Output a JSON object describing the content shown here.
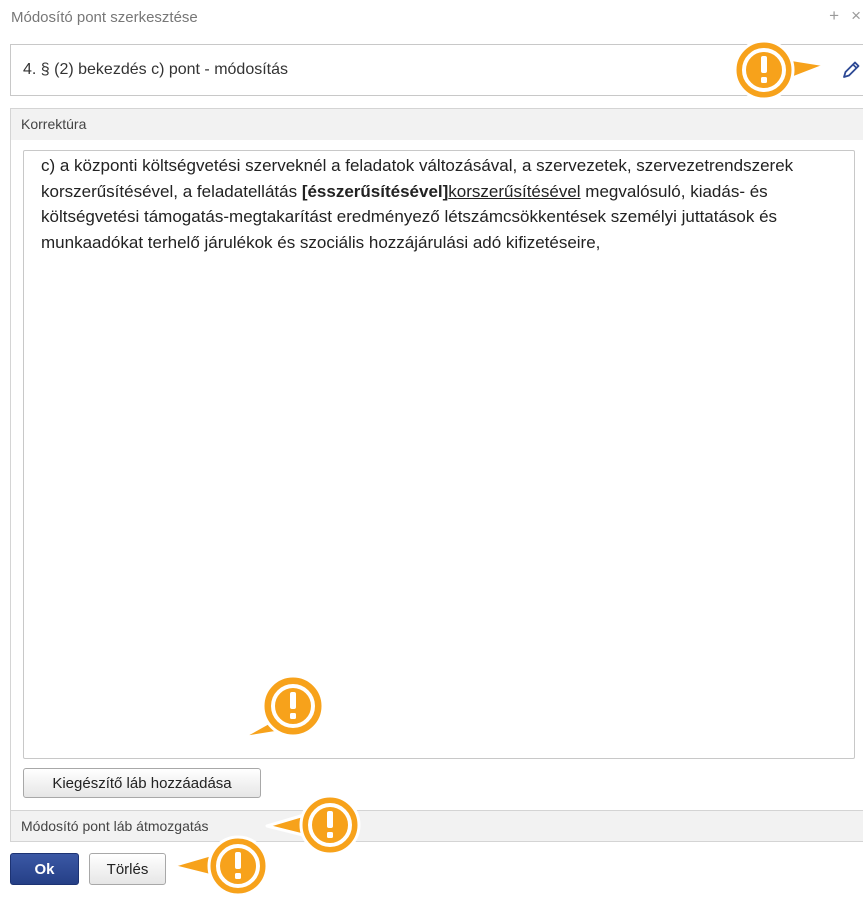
{
  "dialog": {
    "title": "Módosító pont szerkesztése",
    "controls": [
      "+",
      "×"
    ]
  },
  "point": {
    "title": "4. § (2) bekezdés c) pont - módosítás",
    "edit_icon": "pencil-icon"
  },
  "korrektura": {
    "label": "Korrektúra",
    "segments": {
      "intro": "c)  a központi költségvetési szerveknél a feladatok változásával, a szervezetek, szervezetrendszerek korszerűsítésével, a feladatellátás ",
      "deleted": "[ésszerűsítésével]",
      "inserted": "korszerűsítésével",
      "rest": " megvalósuló, kiadás- és költségvetési támogatás-megtakarítást eredményező létszámcsökkentések személyi juttatások és munkaadókat terhelő járulékok és szociális hozzájárulási adó kifizetéseire,"
    }
  },
  "buttons": {
    "add_footer": "Kiegészítő láb hozzáadása",
    "ok": "Ok",
    "delete": "Törlés"
  },
  "footer_section": {
    "label": "Módosító pont láb átmozgatás"
  },
  "colors": {
    "callout": "#f7a21b",
    "primary": "#2c4894",
    "pencil": "#2c4894"
  }
}
